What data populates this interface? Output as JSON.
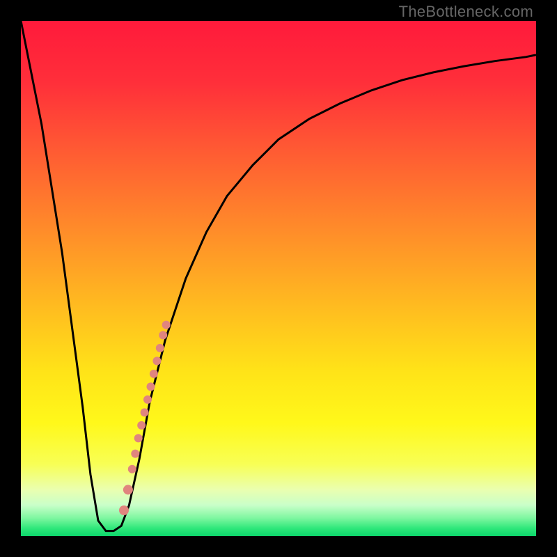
{
  "attribution": "TheBottleneck.com",
  "colors": {
    "frame": "#000000",
    "attribution_text": "#666666",
    "curve": "#000000",
    "dot": "#e0857e",
    "gradient_stops": [
      {
        "offset": 0.0,
        "color": "#ff1a3b"
      },
      {
        "offset": 0.12,
        "color": "#ff2f3a"
      },
      {
        "offset": 0.25,
        "color": "#ff5a33"
      },
      {
        "offset": 0.4,
        "color": "#ff8a2a"
      },
      {
        "offset": 0.55,
        "color": "#ffba20"
      },
      {
        "offset": 0.68,
        "color": "#ffe318"
      },
      {
        "offset": 0.78,
        "color": "#fff81a"
      },
      {
        "offset": 0.86,
        "color": "#f8ff55"
      },
      {
        "offset": 0.91,
        "color": "#eaffb0"
      },
      {
        "offset": 0.94,
        "color": "#c9ffc9"
      },
      {
        "offset": 0.965,
        "color": "#7ef7a0"
      },
      {
        "offset": 0.985,
        "color": "#2ee77a"
      },
      {
        "offset": 1.0,
        "color": "#0cd66b"
      }
    ]
  },
  "chart_data": {
    "type": "line",
    "title": "",
    "xlabel": "",
    "ylabel": "",
    "xlim": [
      0,
      100
    ],
    "ylim": [
      0,
      100
    ],
    "series": [
      {
        "name": "bottleneck-curve",
        "x": [
          0,
          4,
          8,
          10,
          12,
          13.5,
          15,
          16.5,
          18,
          19.5,
          21,
          23,
          25,
          28,
          32,
          36,
          40,
          45,
          50,
          56,
          62,
          68,
          74,
          80,
          86,
          92,
          98,
          100
        ],
        "y": [
          100,
          80,
          55,
          40,
          25,
          12,
          3,
          1,
          1,
          2,
          6,
          15,
          26,
          38,
          50,
          59,
          66,
          72,
          77,
          81,
          84,
          86.5,
          88.5,
          90,
          91.2,
          92.2,
          93,
          93.4
        ]
      }
    ],
    "points": [
      {
        "x": 20.0,
        "y": 5.0,
        "r": 7
      },
      {
        "x": 20.8,
        "y": 9.0,
        "r": 7
      },
      {
        "x": 21.6,
        "y": 13.0,
        "r": 6
      },
      {
        "x": 22.2,
        "y": 16.0,
        "r": 6
      },
      {
        "x": 22.8,
        "y": 19.0,
        "r": 6
      },
      {
        "x": 23.4,
        "y": 21.5,
        "r": 6
      },
      {
        "x": 24.0,
        "y": 24.0,
        "r": 6
      },
      {
        "x": 24.6,
        "y": 26.5,
        "r": 6
      },
      {
        "x": 25.2,
        "y": 29.0,
        "r": 6
      },
      {
        "x": 25.8,
        "y": 31.5,
        "r": 6
      },
      {
        "x": 26.4,
        "y": 34.0,
        "r": 6
      },
      {
        "x": 27.0,
        "y": 36.5,
        "r": 6
      },
      {
        "x": 27.6,
        "y": 39.0,
        "r": 6
      },
      {
        "x": 28.2,
        "y": 41.0,
        "r": 6
      }
    ],
    "grid": false,
    "legend": false
  }
}
